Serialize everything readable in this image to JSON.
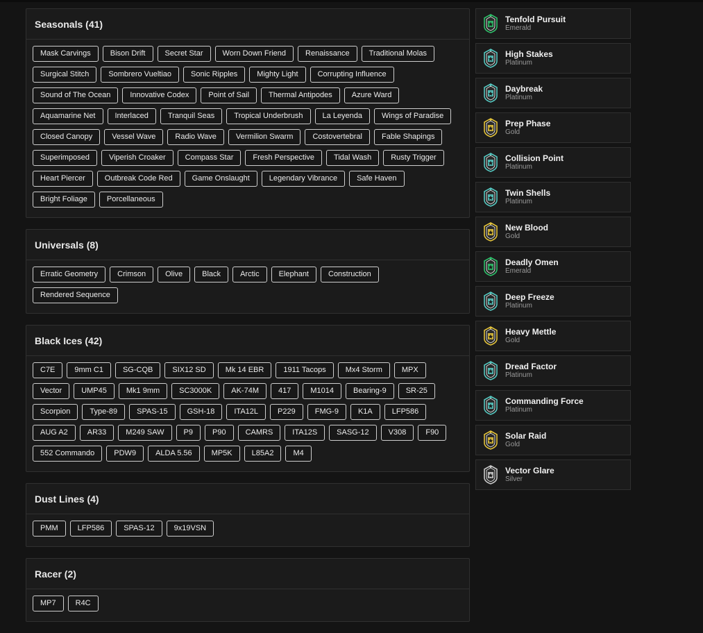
{
  "sections": [
    {
      "title": "Seasonals (41)",
      "items": [
        "Mask Carvings",
        "Bison Drift",
        "Secret Star",
        "Worn Down Friend",
        "Renaissance",
        "Traditional Molas",
        "Surgical Stitch",
        "Sombrero Vueltiao",
        "Sonic Ripples",
        "Mighty Light",
        "Corrupting Influence",
        "Sound of The Ocean",
        "Innovative Codex",
        "Point of Sail",
        "Thermal Antipodes",
        "Azure Ward",
        "Aquamarine Net",
        "Interlaced",
        "Tranquil Seas",
        "Tropical Underbrush",
        "La Leyenda",
        "Wings of Paradise",
        "Closed Canopy",
        "Vessel Wave",
        "Radio Wave",
        "Vermilion Swarm",
        "Costovertebral",
        "Fable Shapings",
        "Superimposed",
        "Viperish Croaker",
        "Compass Star",
        "Fresh Perspective",
        "Tidal Wash",
        "Rusty Trigger",
        "Heart Piercer",
        "Outbreak Code Red",
        "Game Onslaught",
        "Legendary Vibrance",
        "Safe Haven",
        "Bright Foliage",
        "Porcellaneous"
      ]
    },
    {
      "title": "Universals (8)",
      "items": [
        "Erratic Geometry",
        "Crimson",
        "Olive",
        "Black",
        "Arctic",
        "Elephant",
        "Construction",
        "Rendered Sequence"
      ]
    },
    {
      "title": "Black Ices (42)",
      "items": [
        "C7E",
        "9mm C1",
        "SG-CQB",
        "SIX12 SD",
        "Mk 14 EBR",
        "1911 Tacops",
        "Mx4 Storm",
        "MPX",
        "Vector",
        "UMP45",
        "Mk1 9mm",
        "SC3000K",
        "AK-74M",
        "417",
        "M1014",
        "Bearing-9",
        "SR-25",
        "Scorpion",
        "Type-89",
        "SPAS-15",
        "GSH-18",
        "ITA12L",
        "P229",
        "FMG-9",
        "K1A",
        "LFP586",
        "AUG A2",
        "AR33",
        "M249 SAW",
        "P9",
        "P90",
        "CAMRS",
        "ITA12S",
        "SASG-12",
        "V308",
        "F90",
        "552 Commando",
        "PDW9",
        "ALDA 5.56",
        "MP5K",
        "L85A2",
        "M4"
      ]
    },
    {
      "title": "Dust Lines (4)",
      "items": [
        "PMM",
        "LFP586",
        "SPAS-12",
        "9x19VSN"
      ]
    },
    {
      "title": "Racer (2)",
      "items": [
        "MP7",
        "R4C"
      ]
    }
  ],
  "tier_colors": {
    "Emerald": "#2fbf6a",
    "Platinum": "#56c7c0",
    "Gold": "#e2c23b",
    "Silver": "#c9c9c9"
  },
  "ranks": [
    {
      "name": "Tenfold Pursuit",
      "tier": "Emerald",
      "icon": "emerald-rank-icon"
    },
    {
      "name": "High Stakes",
      "tier": "Platinum",
      "icon": "platinum-rank-icon"
    },
    {
      "name": "Daybreak",
      "tier": "Platinum",
      "icon": "platinum-rank-icon"
    },
    {
      "name": "Prep Phase",
      "tier": "Gold",
      "icon": "gold-rank-icon"
    },
    {
      "name": "Collision Point",
      "tier": "Platinum",
      "icon": "platinum-rank-icon"
    },
    {
      "name": "Twin Shells",
      "tier": "Platinum",
      "icon": "platinum-rank-icon"
    },
    {
      "name": "New Blood",
      "tier": "Gold",
      "icon": "gold-rank-icon"
    },
    {
      "name": "Deadly Omen",
      "tier": "Emerald",
      "icon": "emerald-rank-icon"
    },
    {
      "name": "Deep Freeze",
      "tier": "Platinum",
      "icon": "platinum-rank-icon"
    },
    {
      "name": "Heavy Mettle",
      "tier": "Gold",
      "icon": "gold-rank-icon"
    },
    {
      "name": "Dread Factor",
      "tier": "Platinum",
      "icon": "platinum-rank-icon"
    },
    {
      "name": "Commanding Force",
      "tier": "Platinum",
      "icon": "platinum-rank-icon"
    },
    {
      "name": "Solar Raid",
      "tier": "Gold",
      "icon": "gold-rank-icon"
    },
    {
      "name": "Vector Glare",
      "tier": "Silver",
      "icon": "silver-rank-icon"
    }
  ]
}
